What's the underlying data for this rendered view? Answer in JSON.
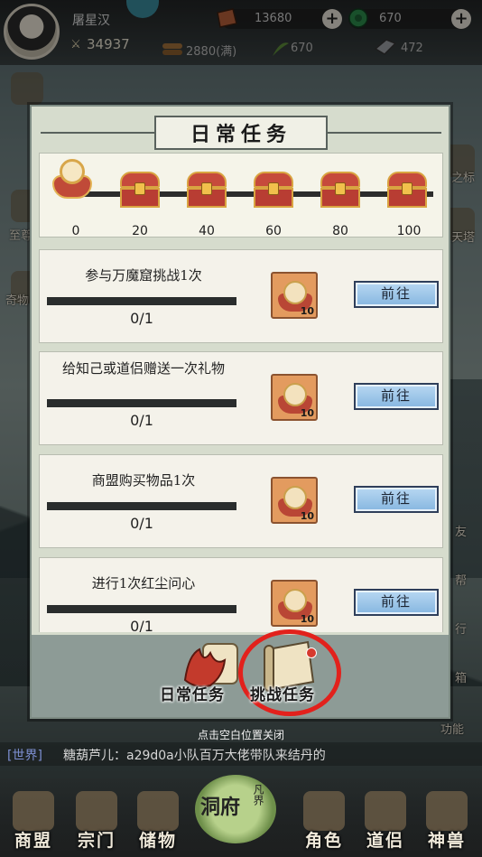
{
  "hud": {
    "player_name": "屠星汉",
    "combat_power": "34937",
    "resources": {
      "ore": "13680",
      "jade": "670",
      "wood": "2880(满)",
      "herb": "670",
      "iron": "472"
    }
  },
  "side_labels": {
    "left_1": "至尊",
    "left_2": "奇物",
    "right_1": "之标",
    "right_2": "天塔",
    "right_3": "友",
    "right_4": "帮",
    "right_5": "行",
    "right_6": "箱",
    "right_7": "功能"
  },
  "modal": {
    "title": "日常任务",
    "milestones": [
      "0",
      "20",
      "40",
      "60",
      "80",
      "100"
    ],
    "tasks": [
      {
        "name": "参与万魔窟挑战1次",
        "progress": "0/1",
        "reward_count": "10",
        "button": "前往"
      },
      {
        "name": "给知己或道侣赠送一次礼物",
        "progress": "0/1",
        "reward_count": "10",
        "button": "前往"
      },
      {
        "name": "商盟购买物品1次",
        "progress": "0/1",
        "reward_count": "10",
        "button": "前往"
      },
      {
        "name": "进行1次红尘问心",
        "progress": "0/1",
        "reward_count": "10",
        "button": "前往"
      }
    ],
    "tabs": {
      "daily": "日常任务",
      "challenge": "挑战任务"
    }
  },
  "close_hint": "点击空白位置关闭",
  "chat": {
    "channel": "[世界]",
    "message": "糖葫芦儿：a29d0a小队百万大佬带队来结丹的"
  },
  "bottom_nav": {
    "shop": "商盟",
    "sect": "宗门",
    "storage": "储物",
    "cave_main": "洞府",
    "cave_sub": "凡界",
    "character": "角色",
    "partner": "道侣",
    "beast": "神兽"
  },
  "colors": {
    "highlight": "#e2211c",
    "go_button": "#86b6e0",
    "chat_channel": "#7d8fd1"
  }
}
